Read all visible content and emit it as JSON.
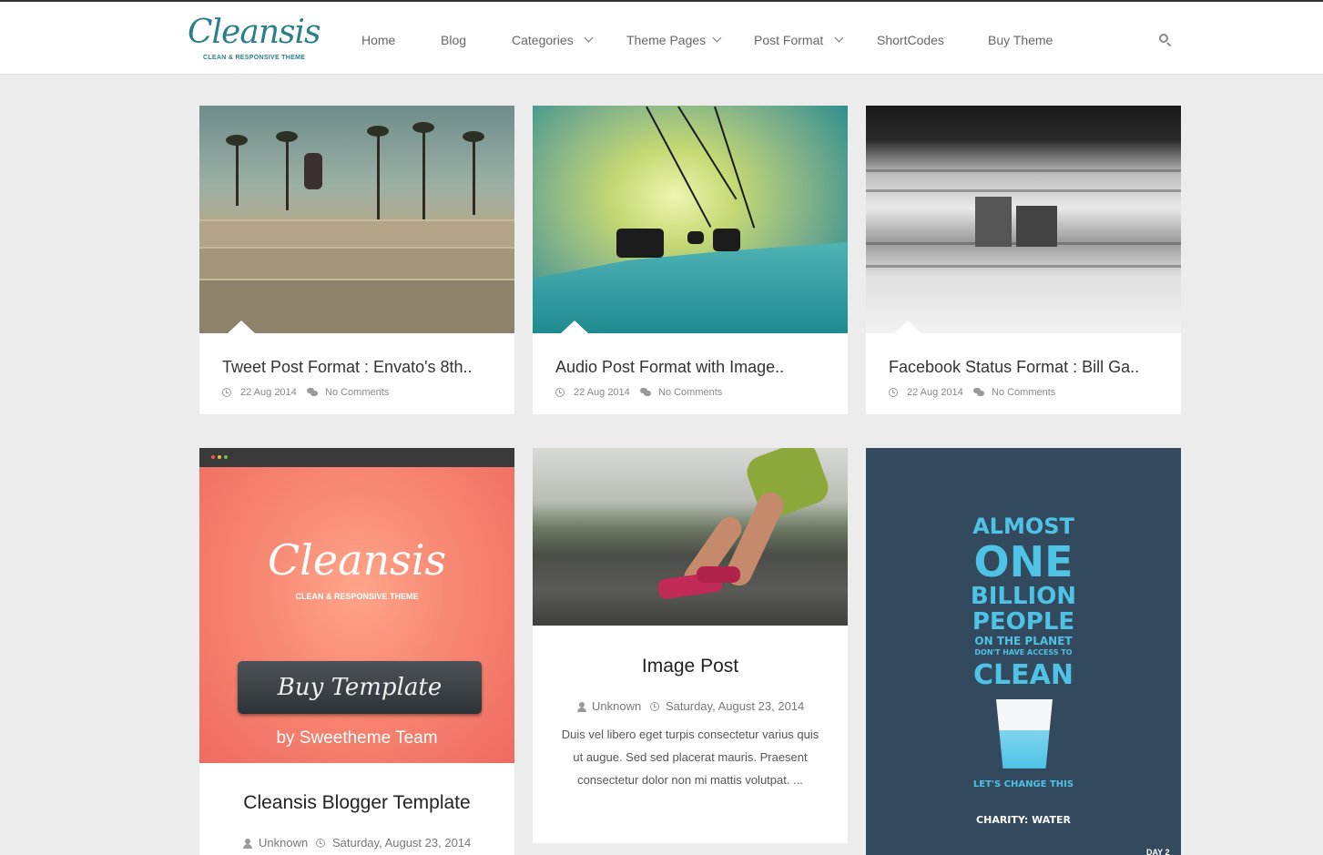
{
  "header": {
    "logo_main": "Cleansis",
    "logo_tagline": "CLEAN & RESPONSIVE THEME",
    "nav": [
      {
        "label": "Home"
      },
      {
        "label": "Blog"
      },
      {
        "label": "Categories"
      },
      {
        "label": "Theme Pages"
      },
      {
        "label": "Post Format"
      },
      {
        "label": "ShortCodes"
      },
      {
        "label": "Buy Theme"
      }
    ]
  },
  "posts_row1": [
    {
      "title": "Tweet Post Format : Envato's 8th..",
      "date": "22 Aug 2014",
      "comments": "No Comments",
      "image": "skateboarder-photo"
    },
    {
      "title": "Audio Post Format with Image..",
      "date": "22 Aug 2014",
      "comments": "No Comments",
      "image": "ski-lift-photo"
    },
    {
      "title": "Facebook Status Format : Bill Ga..",
      "date": "22 Aug 2014",
      "comments": "No Comments",
      "image": "train-motion-photo"
    }
  ],
  "post_buy": {
    "title": "Cleansis Blogger Template",
    "author": "Unknown",
    "date": "Saturday, August 23, 2014",
    "image_logo": "Cleansis",
    "image_tagline": "CLEAN & RESPONSIVE THEME",
    "image_button": "Buy Template",
    "image_by": "by Sweetheme Team"
  },
  "post_image": {
    "title": "Image Post",
    "author": "Unknown",
    "date": "Saturday, August 23, 2014",
    "excerpt": "Duis vel libero eget turpis consectetur varius quis ut augue. Sed sed placerat mauris. Praesent consectetur dolor non mi mattis volutpat. ..."
  },
  "post_charity": {
    "lines": [
      "ALMOST",
      "ONE",
      "BILLION",
      "PEOPLE",
      "ON THE PLANET",
      "DON'T HAVE ACCESS TO",
      "CLEAN"
    ],
    "tagline": "LET'S CHANGE THIS",
    "brand": "CHARITY: WATER",
    "corner": "DAY 2"
  },
  "colors": {
    "accent": "#2a7f8c",
    "charity_bg": "#33495e",
    "charity_text": "#4fc3e6",
    "buy_bg": "#f88a74"
  }
}
